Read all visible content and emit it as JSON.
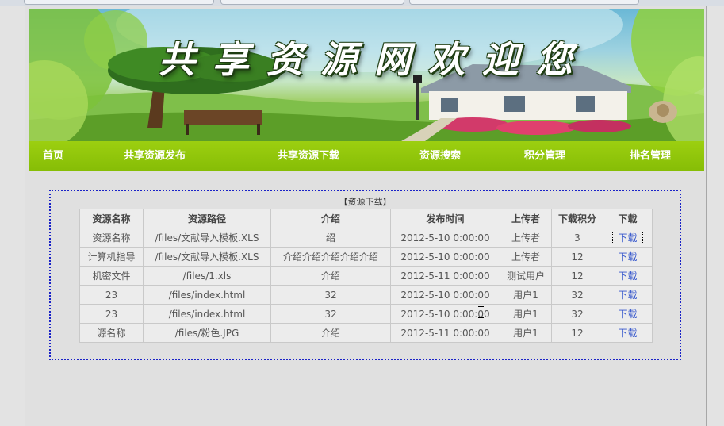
{
  "banner": {
    "title": "共享资源网欢迎您"
  },
  "nav": {
    "items": [
      {
        "label": "首页"
      },
      {
        "label": "共享资源发布"
      },
      {
        "label": "共享资源下载"
      },
      {
        "label": "资源搜索"
      },
      {
        "label": "积分管理"
      },
      {
        "label": "排名管理"
      }
    ]
  },
  "panel": {
    "title": "【资源下载】"
  },
  "table": {
    "headers": [
      "资源名称",
      "资源路径",
      "介绍",
      "发布时间",
      "上传者",
      "下载积分",
      "下载"
    ],
    "rows": [
      {
        "name": "资源名称",
        "path": "/files/文献导入模板.XLS",
        "intro": "绍",
        "time": "2012-5-10 0:00:00",
        "uploader": "上传者",
        "points": "3",
        "download": "下载"
      },
      {
        "name": "计算机指导",
        "path": "/files/文献导入模板.XLS",
        "intro": "介绍介绍介绍介绍介绍",
        "time": "2012-5-10 0:00:00",
        "uploader": "上传者",
        "points": "12",
        "download": "下载"
      },
      {
        "name": "机密文件",
        "path": "/files/1.xls",
        "intro": "介绍",
        "time": "2012-5-11 0:00:00",
        "uploader": "测试用户",
        "points": "12",
        "download": "下载"
      },
      {
        "name": "23",
        "path": "/files/index.html",
        "intro": "32",
        "time": "2012-5-10 0:00:00",
        "uploader": "用户1",
        "points": "32",
        "download": "下载"
      },
      {
        "name": "23",
        "path": "/files/index.html",
        "intro": "32",
        "time": "2012-5-10 0:00:00",
        "uploader": "用户1",
        "points": "32",
        "download": "下载"
      },
      {
        "name": "源名称",
        "path": "/files/粉色.JPG",
        "intro": "介绍",
        "time": "2012-5-11 0:00:00",
        "uploader": "用户1",
        "points": "12",
        "download": "下载"
      }
    ]
  }
}
